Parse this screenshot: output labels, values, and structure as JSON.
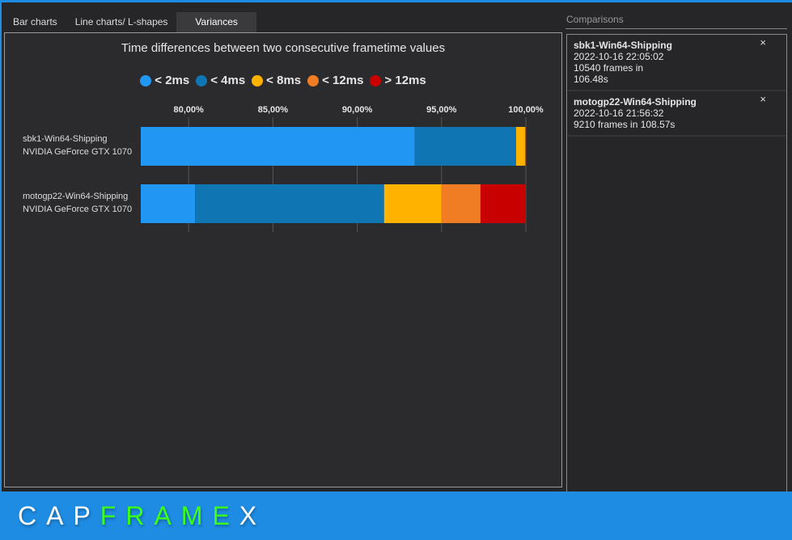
{
  "tabs": [
    "Bar charts",
    "Line charts/ L-shapes",
    "Variances"
  ],
  "chart_data": {
    "type": "bar",
    "title": "Time differences between two consecutive frametime values",
    "legend": [
      {
        "label": "< 2ms",
        "color": "#2196f3"
      },
      {
        "label": "< 4ms",
        "color": "#0f75b3"
      },
      {
        "label": "< 8ms",
        "color": "#ffb300"
      },
      {
        "label": "< 12ms",
        "color": "#f07d23"
      },
      {
        "label": "> 12ms",
        "color": "#c80000"
      }
    ],
    "xlim": [
      77.16,
      100
    ],
    "xticks": [
      80,
      85,
      90,
      95,
      100
    ],
    "xtick_labels": [
      "80,00%",
      "85,00%",
      "90,00%",
      "95,00%",
      "100,00%"
    ],
    "categories": [
      [
        "sbk1-Win64-Shipping",
        "NVIDIA GeForce GTX 1070"
      ],
      [
        "motogp22-Win64-Shipping",
        "NVIDIA GeForce GTX 1070"
      ]
    ],
    "series": [
      {
        "name": "< 2ms",
        "values": [
          93.41,
          80.38
        ]
      },
      {
        "name": "< 4ms",
        "values": [
          6.01,
          11.21
        ]
      },
      {
        "name": "< 8ms",
        "values": [
          0.53,
          3.41
        ]
      },
      {
        "name": "< 12ms",
        "values": [
          0.03,
          2.31
        ]
      },
      {
        "name": "> 12ms",
        "values": [
          0.02,
          2.69
        ]
      }
    ]
  },
  "comparisons": {
    "title": "Comparisons",
    "items": [
      {
        "name": "sbk1-Win64-Shipping",
        "date": "2022-10-16 22:05:02",
        "frames": "10540 frames in",
        "time": "106.48s"
      },
      {
        "name": "motogp22-Win64-Shipping",
        "date": "2022-10-16 21:56:32",
        "frames": "9210 frames in 108.57s",
        "time": ""
      }
    ],
    "close_glyph": "×"
  },
  "footer": {
    "logo_a": "CAP",
    "logo_b": "FRAME",
    "logo_c": "X"
  }
}
